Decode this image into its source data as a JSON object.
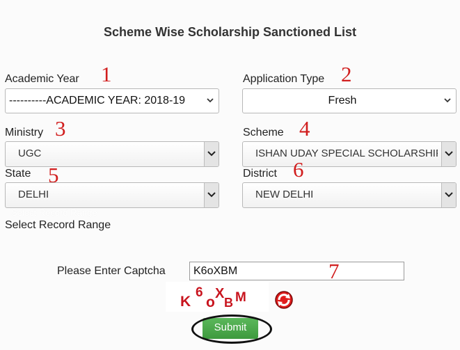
{
  "page": {
    "title": "Scheme Wise Scholarship Sanctioned List"
  },
  "form": {
    "academic_year": {
      "label": "Academic Year",
      "marker": "1",
      "value": "----------ACADEMIC YEAR: 2018-19"
    },
    "application_type": {
      "label": "Application Type",
      "marker": "2",
      "value": "Fresh"
    },
    "ministry": {
      "label": "Ministry",
      "marker": "3",
      "value": "UGC"
    },
    "scheme": {
      "label": "Scheme",
      "marker": "4",
      "value": "ISHAN UDAY SPECIAL SCHOLARSHIP"
    },
    "state": {
      "label": "State",
      "marker": "5",
      "value": "DELHI"
    },
    "district": {
      "label": "District",
      "marker": "6",
      "value": "NEW DELHI"
    },
    "record_range": {
      "label": "Select Record Range",
      "ghost_label": "Select Record Range"
    },
    "captcha": {
      "label": "Please Enter Captcha",
      "value": "K6oXBM",
      "marker": "7",
      "image_chars": [
        "K",
        "6",
        "o",
        "X",
        "B",
        "M"
      ]
    },
    "submit_label": "Submit"
  },
  "colors": {
    "marker": "#d11e1e",
    "captcha_text": "#c8141e",
    "submit": "#4caf50"
  },
  "icons": {
    "refresh": "refresh-captcha-icon",
    "dropdown": "chevron-down-icon"
  }
}
